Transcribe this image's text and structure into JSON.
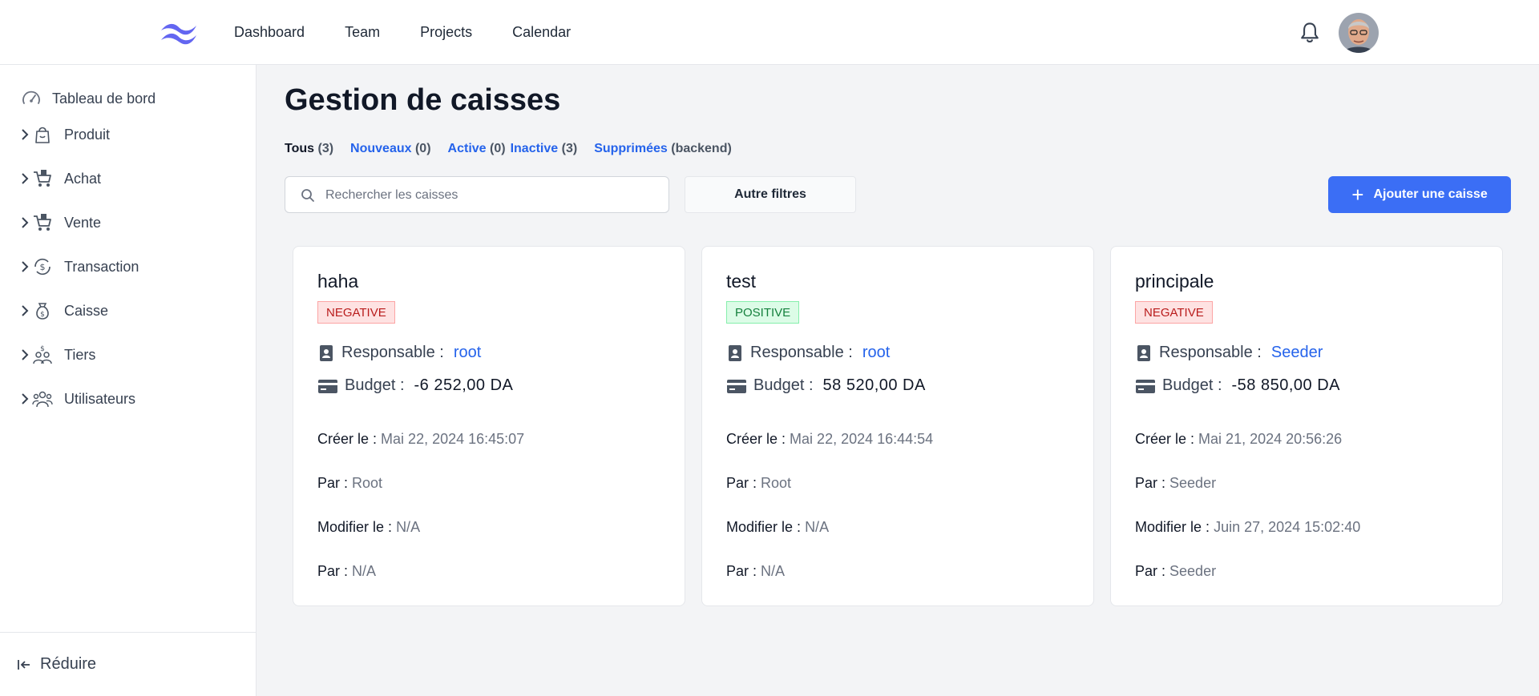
{
  "nav": {
    "items": [
      "Dashboard",
      "Team",
      "Projects",
      "Calendar"
    ]
  },
  "sidebar": {
    "items": [
      {
        "label": "Tableau de bord",
        "icon": "gauge-icon"
      },
      {
        "label": "Produit",
        "icon": "bag-icon"
      },
      {
        "label": "Achat",
        "icon": "cart-icon"
      },
      {
        "label": "Vente",
        "icon": "cart-icon"
      },
      {
        "label": "Transaction",
        "icon": "money-exchange-icon"
      },
      {
        "label": "Caisse",
        "icon": "money-bag-icon"
      },
      {
        "label": "Tiers",
        "icon": "people-money-icon"
      },
      {
        "label": "Utilisateurs",
        "icon": "users-icon"
      }
    ],
    "collapse_label": "Réduire"
  },
  "main": {
    "title": "Gestion de caisses",
    "filters": [
      {
        "label": "Tous",
        "count": "(3)"
      },
      {
        "label": "Nouveaux",
        "count": "(0)"
      },
      {
        "label": "Active",
        "count": "(0)"
      },
      {
        "label": "Inactive",
        "count": "(3)"
      },
      {
        "label": "Supprimées",
        "count": "(backend)"
      }
    ],
    "search_placeholder": "Rechercher les caisses",
    "other_filters_label": "Autre filtres",
    "add_button_label": "Ajouter une caisse"
  },
  "labels": {
    "responsable": "Responsable :",
    "budget": "Budget :",
    "created": "Créer le :",
    "by": "Par :",
    "modified": "Modifier le :"
  },
  "cards": [
    {
      "name": "haha",
      "status": "NEGATIVE",
      "responsable": "root",
      "budget": "-6 252,00 DA",
      "created_at": "Mai 22, 2024 16:45:07",
      "created_by": "Root",
      "modified_at": "N/A",
      "modified_by": "N/A"
    },
    {
      "name": "test",
      "status": "POSITIVE",
      "responsable": "root",
      "budget": "58 520,00 DA",
      "created_at": "Mai 22, 2024 16:44:54",
      "created_by": "Root",
      "modified_at": "N/A",
      "modified_by": "N/A"
    },
    {
      "name": "principale",
      "status": "NEGATIVE",
      "responsable": "Seeder",
      "budget": "-58 850,00 DA",
      "created_at": "Mai 21, 2024 20:56:26",
      "created_by": "Seeder",
      "modified_at": "Juin 27, 2024 15:02:40",
      "modified_by": "Seeder"
    }
  ],
  "colors": {
    "accent": "#3b6ef5",
    "link": "#2563eb",
    "negative_bg": "#fee2e2",
    "positive_bg": "#dcfce7"
  }
}
